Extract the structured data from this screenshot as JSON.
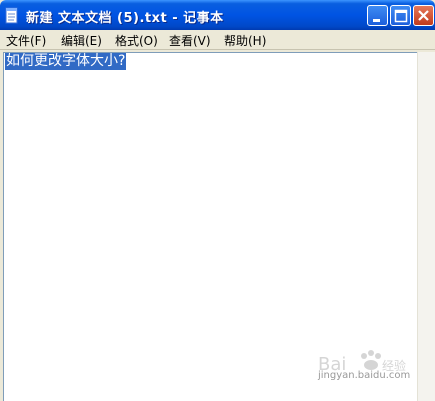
{
  "window": {
    "title": "新建 文本文档 (5).txt - 记事本",
    "titlebar_color": "#0054e3",
    "close_color": "#c13b1c"
  },
  "menu": {
    "items": [
      {
        "label": "文件(F)"
      },
      {
        "label": "编辑(E)"
      },
      {
        "label": "格式(O)"
      },
      {
        "label": "查看(V)"
      },
      {
        "label": "帮助(H)"
      }
    ]
  },
  "editor": {
    "text": "如何更改字体大小?",
    "selection_color": "#316ac5"
  },
  "watermark": {
    "text": "jingyan.baidu.com"
  }
}
